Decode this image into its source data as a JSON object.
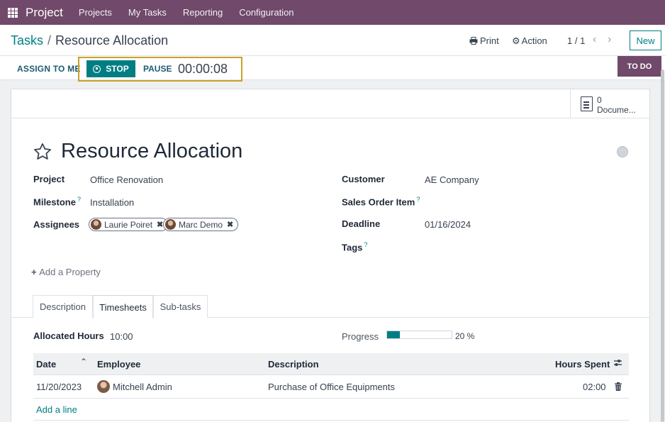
{
  "topnav": {
    "app_name": "Project",
    "items": [
      "Projects",
      "My Tasks",
      "Reporting",
      "Configuration"
    ]
  },
  "control_panel": {
    "breadcrumb_parent": "Tasks",
    "breadcrumb_separator": "/",
    "breadcrumb_current": "Resource Allocation",
    "print_label": "Print",
    "action_label": "Action",
    "pager": "1 / 1",
    "new_label": "New"
  },
  "statusbar": {
    "assign_me_label": "ASSIGN TO ME",
    "stop_label": "STOP",
    "pause_label": "PAUSE",
    "timer": "00:00:08",
    "stage": "TO DO"
  },
  "button_box": {
    "documents_count": "0",
    "documents_label": "Docume..."
  },
  "task": {
    "title": "Resource Allocation",
    "fields": {
      "project_label": "Project",
      "project_value": "Office Renovation",
      "milestone_label": "Milestone",
      "milestone_value": "Installation",
      "assignees_label": "Assignees",
      "assignees": [
        "Laurie Poiret",
        "Marc Demo"
      ],
      "customer_label": "Customer",
      "customer_value": "AE Company",
      "sales_order_item_label": "Sales Order Item",
      "deadline_label": "Deadline",
      "deadline_value": "01/16/2024",
      "tags_label": "Tags",
      "help_marker": "?"
    },
    "add_property_label": "Add a Property"
  },
  "tabs": [
    "Description",
    "Timesheets",
    "Sub-tasks"
  ],
  "active_tab": "Timesheets",
  "timesheets": {
    "allocated_hours_label": "Allocated Hours",
    "allocated_hours_value": "10:00",
    "progress_label": "Progress",
    "progress_value": "20 %",
    "progress_fraction": 0.2,
    "columns": [
      "Date",
      "Employee",
      "Description",
      "Hours Spent"
    ],
    "rows": [
      {
        "date": "11/20/2023",
        "employee": "Mitchell Admin",
        "description": "Purchase of Office Equipments",
        "hours": "02:00"
      }
    ],
    "add_line_label": "Add a line"
  },
  "colors": {
    "brand": "#71496a",
    "accent": "#017e84",
    "highlight_border": "#c9a227"
  }
}
